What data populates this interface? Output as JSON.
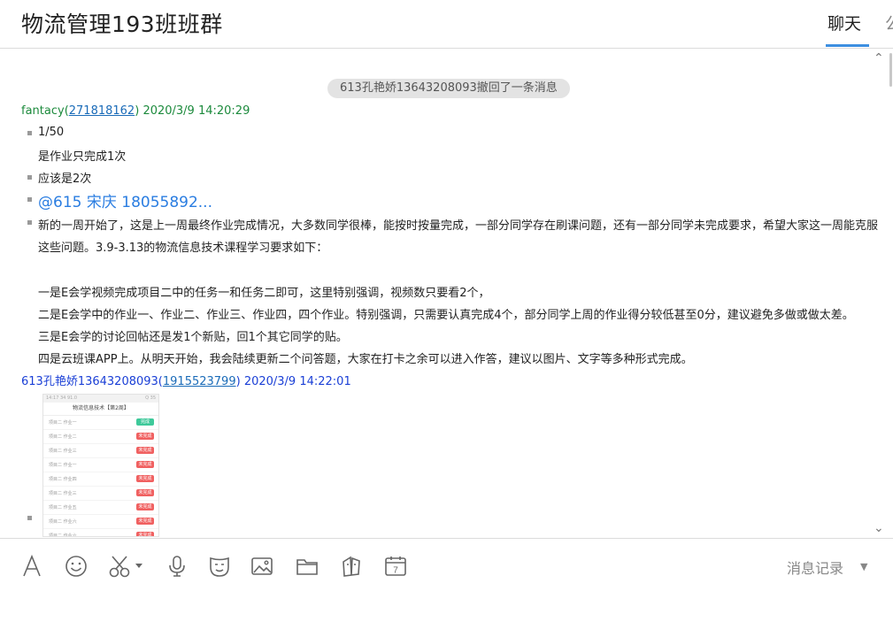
{
  "header": {
    "title": "物流管理193班班群",
    "tabs": [
      {
        "label": "聊天",
        "active": true
      },
      {
        "label": "公",
        "active": false
      }
    ]
  },
  "chat": {
    "system_notice": "613孔艳娇13643208093撤回了一条消息",
    "messages": [
      {
        "sender_name": "fantacy",
        "sender_id": "271818162",
        "time": "2020/3/9 14:20:29",
        "items": [
          {
            "lines": [
              "1/50",
              "是作业只完成1次"
            ]
          },
          {
            "lines": [
              "应该是2次"
            ]
          },
          {
            "mention": "@615  宋庆  18055892..."
          },
          {
            "lines": [
              "新的一周开始了，这是上一周最终作业完成情况，大多数同学很棒，能按时按量完成，一部分同学存在刷课问题，还有一部分同学未完成要求，希望大家这一周能克服",
              "这些问题。3.9-3.13的物流信息技术课程学习要求如下：",
              "",
              "一是E会学视频完成项目二中的任务一和任务二即可，这里特别强调，视频数只要看2个，",
              "二是E会学中的作业一、作业二、作业三、作业四，四个作业。特别强调，只需要认真完成4个，部分同学上周的作业得分较低甚至0分，建议避免多做或做太差。",
              "三是E会学的讨论回帖还是发1个新贴，回1个其它同学的贴。",
              "四是云班课APP上。从明天开始，我会陆续更新二个问答题，大家在打卡之余可以进入作答，建议以图片、文字等多种形式完成。"
            ]
          }
        ]
      },
      {
        "sender_name": "613孔艳娇13643208093",
        "sender_id": "1915523799",
        "time": "2020/3/9 14:22:01",
        "image": {
          "status_bar": "14:17  34  91.0   ",
          "status_right": "Q 35",
          "title": "物流信息技术【第2周】",
          "rows": [
            {
              "label": "项目二 作业一",
              "tag": "完成",
              "tag_color": "#3ec99a"
            },
            {
              "label": "项目二 作业二",
              "tag": "未完成",
              "tag_color": "#f06060"
            },
            {
              "label": "项目二 作业三",
              "tag": "未完成",
              "tag_color": "#f06060"
            },
            {
              "label": "项目二 作业一",
              "tag": "未完成",
              "tag_color": "#f06060"
            },
            {
              "label": "项目二 作业四",
              "tag": "未完成",
              "tag_color": "#f06060"
            },
            {
              "label": "项目二 作业三",
              "tag": "未完成",
              "tag_color": "#f06060"
            },
            {
              "label": "项目二 作业五",
              "tag": "未完成",
              "tag_color": "#f06060"
            },
            {
              "label": "项目二 作业六",
              "tag": "未完成",
              "tag_color": "#f06060"
            },
            {
              "label": "项目二 作业六",
              "tag": "未完成",
              "tag_color": "#f06060"
            }
          ]
        }
      }
    ]
  },
  "toolbar": {
    "icons": [
      "font-icon",
      "emoji-icon",
      "screenshot-scissors-icon",
      "voice-mic-icon",
      "sticker-icon",
      "image-icon",
      "folder-icon",
      "gift-box-icon",
      "calendar-icon"
    ],
    "calendar_day": "7",
    "history_label": "消息记录",
    "history_caret": "▼"
  },
  "colors": {
    "accent": "#3d8fe0",
    "sender_green": "#1c8a3c",
    "sender_blue": "#1a3fd6",
    "mention": "#2a7de1"
  }
}
